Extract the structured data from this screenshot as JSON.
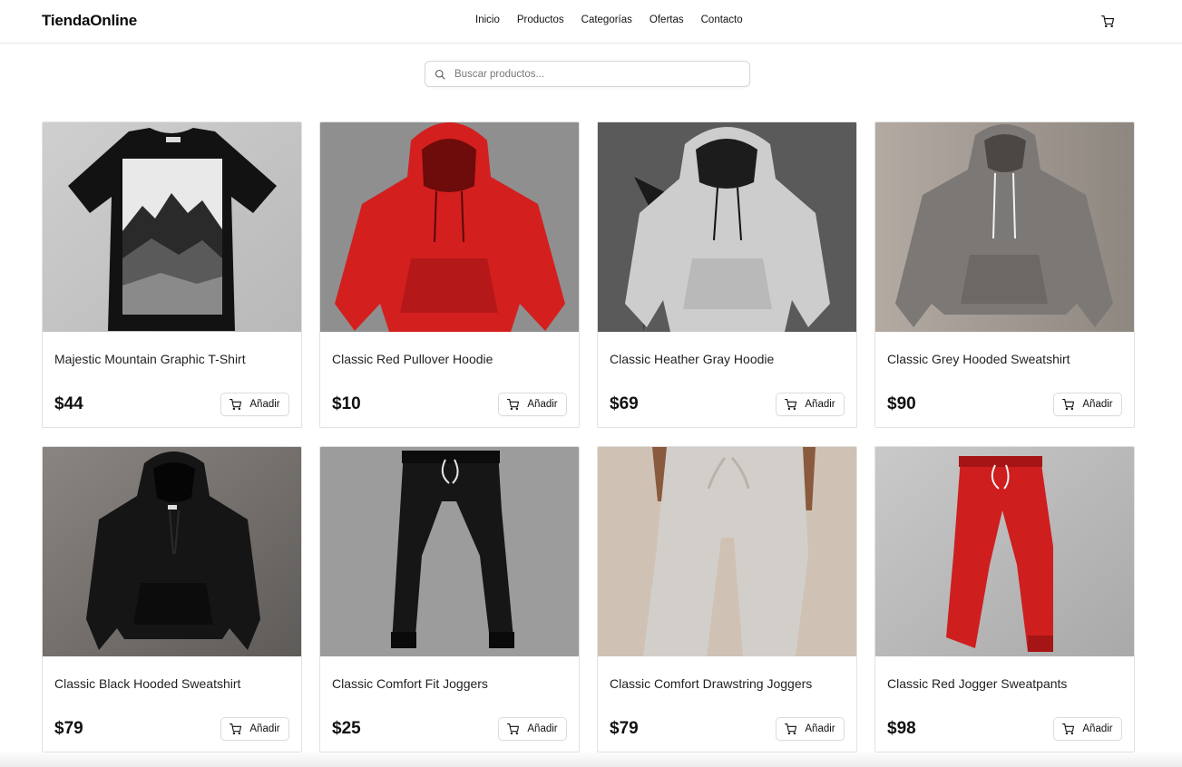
{
  "brand": {
    "name": "TiendaOnline"
  },
  "nav": [
    {
      "label": "Inicio"
    },
    {
      "label": "Productos"
    },
    {
      "label": "Categorías"
    },
    {
      "label": "Ofertas"
    },
    {
      "label": "Contacto"
    }
  ],
  "header_icons": {
    "cart": "cart-icon"
  },
  "search": {
    "placeholder": "Buscar productos...",
    "value": ""
  },
  "products": [
    {
      "name": "Majestic Mountain Graphic T-Shirt",
      "price": "$44",
      "button": "Añadir",
      "image": "black-tshirt-mountain-print"
    },
    {
      "name": "Classic Red Pullover Hoodie",
      "price": "$10",
      "button": "Añadir",
      "image": "red-hoodie"
    },
    {
      "name": "Classic Heather Gray Hoodie",
      "price": "$69",
      "button": "Añadir",
      "image": "light-gray-hoodie"
    },
    {
      "name": "Classic Grey Hooded Sweatshirt",
      "price": "$90",
      "button": "Añadir",
      "image": "grey-hoodie"
    },
    {
      "name": "Classic Black Hooded Sweatshirt",
      "price": "$79",
      "button": "Añadir",
      "image": "black-hoodie"
    },
    {
      "name": "Classic Comfort Fit Joggers",
      "price": "$25",
      "button": "Añadir",
      "image": "black-joggers"
    },
    {
      "name": "Classic Comfort Drawstring Joggers",
      "price": "$79",
      "button": "Añadir",
      "image": "beige-joggers"
    },
    {
      "name": "Classic Red Jogger Sweatpants",
      "price": "$98",
      "button": "Añadir",
      "image": "red-joggers"
    }
  ],
  "colors": {
    "border": "#e2e2e2",
    "text": "#111111",
    "muted": "#777777"
  }
}
